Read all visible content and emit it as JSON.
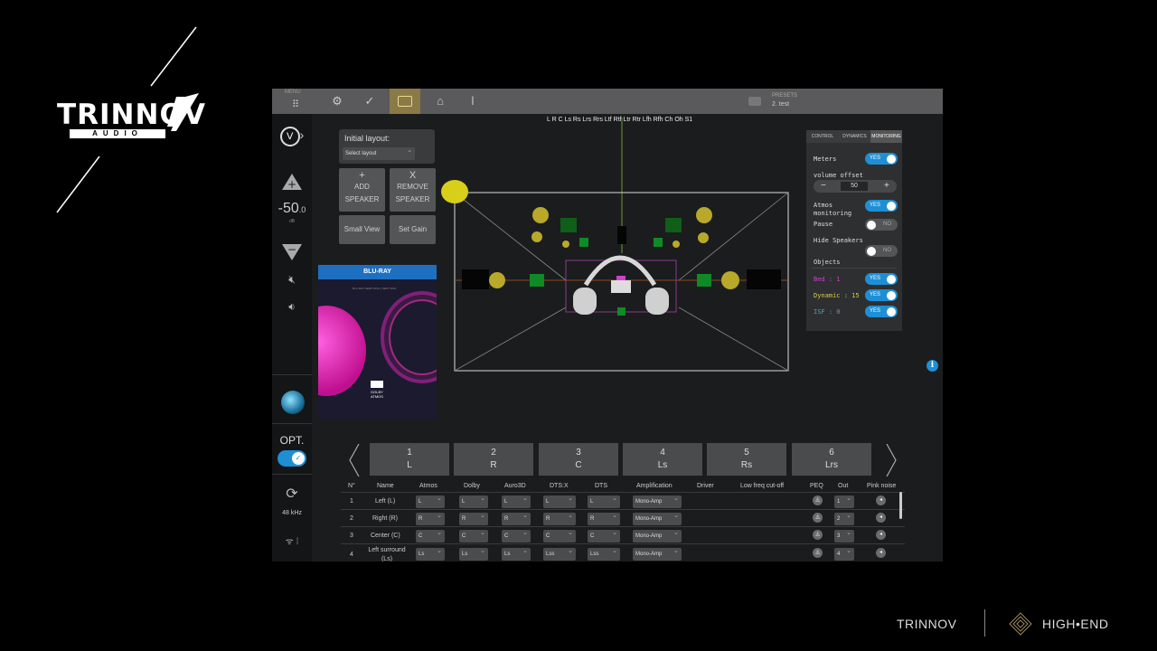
{
  "branding": {
    "logo_word": "TRINNOV",
    "logo_sub": "AUDIO",
    "footer_left": "TRINNOV",
    "footer_right": "HIGH•END"
  },
  "app": {
    "topbar": {
      "menu_label": "MENU",
      "preset_label": "PRESETS",
      "preset_name": "2. test"
    },
    "channel_header": "L R C Ls Rs Lrs Rrs Ltf Rtf Ltr Rtr Lfh Rfh Ch Oh S1",
    "leftbar": {
      "volume_value": "-50",
      "volume_decimal": ".0",
      "volume_unit": "dB",
      "opt_label": "OPT.",
      "sample_rate": "48 kHz"
    },
    "layout": {
      "initial_layout_label": "Initial layout:",
      "select_placeholder": "Select layout",
      "add_symbol": "+",
      "add_line1": "ADD",
      "add_line2": "SPEAKER",
      "remove_symbol": "X",
      "remove_line1": "REMOVE",
      "remove_line2": "SPEAKER",
      "small_view": "Small View",
      "set_gain": "Set Gain"
    },
    "cover": {
      "title": "BLU-RAY",
      "caption": "BLU-RAY DEMO DISC | SEPT 2024",
      "dolby_line1": "DOLBY",
      "dolby_line2": "ATMOS"
    },
    "right_panel": {
      "tabs": [
        "CONTROL",
        "DYNAMICS",
        "MONITORING"
      ],
      "meters_label": "Meters",
      "meters_state": "YES",
      "volume_offset_label": "volume offset",
      "volume_offset_value": "50",
      "minus": "−",
      "plus": "+",
      "atmos_label1": "Atmos",
      "atmos_label2": "monitoring",
      "atmos_state": "YES",
      "pause_label": "Pause",
      "pause_state": "NO",
      "hide_speakers_label": "Hide Speakers",
      "hide_speakers_state": "NO",
      "objects_label": "Objects",
      "bed_label": "Bed : 1",
      "bed_state": "YES",
      "bed_color": "#d040d0",
      "dynamic_label": "Dynamic : 15",
      "dynamic_state": "YES",
      "dynamic_color": "#d8d040",
      "isf_label": "ISF : 0",
      "isf_state": "YES",
      "isf_color": "#40a8b0"
    },
    "channel_tabs": [
      {
        "num": "1",
        "name": "L"
      },
      {
        "num": "2",
        "name": "R"
      },
      {
        "num": "3",
        "name": "C"
      },
      {
        "num": "4",
        "name": "Ls"
      },
      {
        "num": "5",
        "name": "Rs"
      },
      {
        "num": "6",
        "name": "Lrs"
      }
    ],
    "table": {
      "headers": [
        "N°",
        "Name",
        "Atmos",
        "Dolby",
        "Auro3D",
        "DTS:X",
        "DTS",
        "Amplification",
        "Driver",
        "Low freq cut-off",
        "PEQ",
        "Out",
        "Pink noise"
      ],
      "rows": [
        {
          "n": "1",
          "name": "Left (L)",
          "atmos": "L",
          "dolby": "L",
          "auro": "L",
          "dtsx": "L",
          "dts": "L",
          "amp": "Mono-Amp",
          "out": "1"
        },
        {
          "n": "2",
          "name": "Right (R)",
          "atmos": "R",
          "dolby": "R",
          "auro": "R",
          "dtsx": "R",
          "dts": "R",
          "amp": "Mono-Amp",
          "out": "2"
        },
        {
          "n": "3",
          "name": "Center (C)",
          "atmos": "C",
          "dolby": "C",
          "auro": "C",
          "dtsx": "C",
          "dts": "C",
          "amp": "Mono-Amp",
          "out": "3"
        },
        {
          "n": "4",
          "name": "Left surround (Ls)",
          "atmos": "Ls",
          "dolby": "Ls",
          "auro": "Ls",
          "dtsx": "Lss",
          "dts": "Lss",
          "amp": "Mono-Amp",
          "out": "4"
        }
      ]
    }
  }
}
